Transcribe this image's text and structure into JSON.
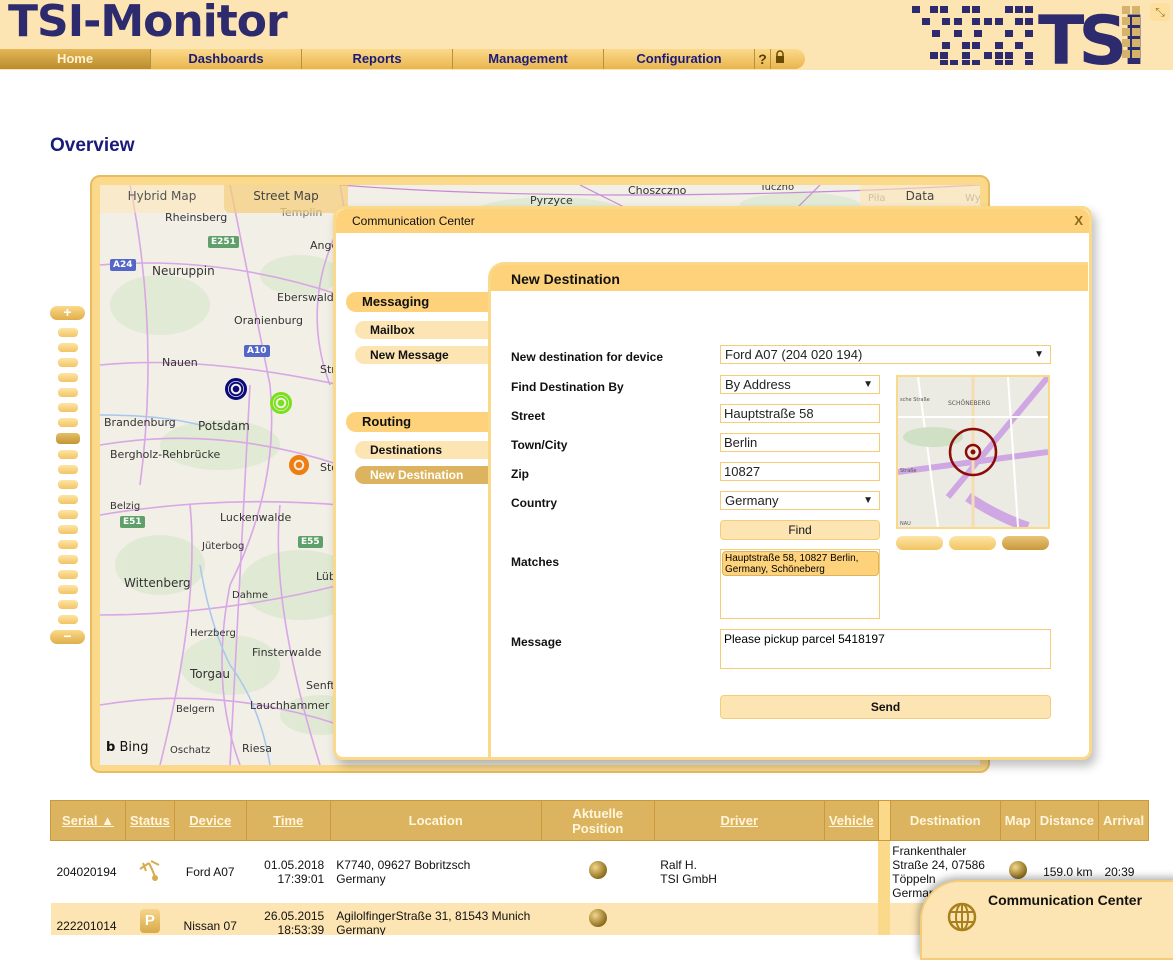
{
  "header": {
    "app_title": "TSI-Monitor",
    "nav": [
      {
        "label": "Home",
        "active": true
      },
      {
        "label": "Dashboards",
        "active": false
      },
      {
        "label": "Reports",
        "active": false
      },
      {
        "label": "Management",
        "active": false
      },
      {
        "label": "Configuration",
        "active": false
      }
    ],
    "help_icon": "?",
    "lock_icon": "lock-icon",
    "logo_text": "TSI",
    "collapse_icon": "collapse-arrows-icon"
  },
  "page_title": "Overview",
  "map": {
    "tabs": [
      "Hybrid Map",
      "Street Map",
      "Data"
    ],
    "attribution": "Bing",
    "labels": [
      "Rheinsberg",
      "Templin",
      "Neuruppin",
      "Ange",
      "Eberswalde",
      "Oranienburg",
      "Nauen",
      "Str",
      "Brandenburg",
      "Potsdam",
      "Bergholz-Rehbrücke",
      "Sto",
      "Belzig",
      "Luckenwalde",
      "Jüterbog",
      "Lüb",
      "Wittenberg",
      "Dahme",
      "Herzberg",
      "Finsterwalde",
      "Torgau",
      "Senft",
      "Belgern",
      "Lauchhammer",
      "Oschatz",
      "Riesa",
      "Pyrzyce",
      "Choszczno",
      "Tuczno",
      "Piła",
      "Wyr"
    ],
    "road_badges": [
      "E251",
      "A24",
      "A10",
      "E51",
      "E55"
    ],
    "markers": [
      {
        "color": "#0a0a7a",
        "name": "navy-vehicle-marker"
      },
      {
        "color": "#79e01a",
        "name": "green-vehicle-marker"
      },
      {
        "color": "#ef7d10",
        "name": "orange-vehicle-marker"
      }
    ],
    "zoom_in": "+",
    "zoom_out": "−",
    "zoom_level_fraction": 0.65
  },
  "comm_center": {
    "title": "Communication Center",
    "close": "X",
    "sidebar": {
      "messaging": {
        "label": "Messaging",
        "items": [
          "Mailbox",
          "New Message"
        ]
      },
      "routing": {
        "label": "Routing",
        "items": [
          "Destinations",
          "New Destination"
        ]
      },
      "active_item": "New Destination"
    },
    "panel": {
      "title": "New Destination",
      "labels": {
        "device": "New destination for device",
        "find_by": "Find Destination By",
        "street": "Street",
        "town": "Town/City",
        "zip": "Zip",
        "country": "Country",
        "matches": "Matches",
        "message": "Message"
      },
      "values": {
        "device": "Ford A07 (204 020 194)",
        "find_by": "By Address",
        "street": "Hauptstraße 58",
        "town": "Berlin",
        "zip": "10827",
        "country": "Germany",
        "match": "Hauptstraße 58,  10827 Berlin, Germany,  Schöneberg",
        "message": "Please pickup parcel 5418197"
      },
      "find_button": "Find",
      "send_button": "Send",
      "mini_map_labels": [
        "SCHÖNEBERG",
        "sche Straße",
        "Straße",
        "NAU"
      ]
    }
  },
  "table": {
    "headers": [
      {
        "label": "Serial ▲",
        "sortable": true
      },
      {
        "label": "Status",
        "sortable": true
      },
      {
        "label": "Device",
        "sortable": true
      },
      {
        "label": "Time",
        "sortable": true
      },
      {
        "label": "Location",
        "sortable": false
      },
      {
        "label": "Aktuelle Position",
        "sortable": false
      },
      {
        "label": "Driver",
        "sortable": true
      },
      {
        "label": "Vehicle",
        "sortable": true
      },
      {
        "label": "Destination",
        "sortable": false
      },
      {
        "label": "Map",
        "sortable": false
      },
      {
        "label": "Distance",
        "sortable": false
      },
      {
        "label": "Arrival",
        "sortable": false
      }
    ],
    "rows": [
      {
        "serial": "204020194",
        "status": "moving",
        "device": "Ford A07",
        "date": "01.05.2018",
        "time": "17:39:01",
        "location1": "K7740, 09627 Bobritzsch",
        "location2": "Germany",
        "driver1": "Ralf H.",
        "driver2": "TSI GmbH",
        "vehicle": "",
        "dest1": "Frankenthaler",
        "dest2": "Straße 24, 07586",
        "dest3": "Töppeln",
        "dest4": "Germany",
        "distance": "159.0 km",
        "arrival": "20:39"
      },
      {
        "serial": "222201014",
        "status": "P",
        "device": "Nissan 07",
        "date": "26.05.2015",
        "time": "18:53:39",
        "location1": "AgilolfingerStraße 31, 81543 Munich",
        "location2": "Germany",
        "driver1": "",
        "driver2": "",
        "vehicle": "",
        "dest1": "",
        "dest2": "",
        "dest3": "",
        "dest4": "",
        "distance": "",
        "arrival": ""
      }
    ]
  },
  "dock": {
    "label": "Communication Center"
  }
}
